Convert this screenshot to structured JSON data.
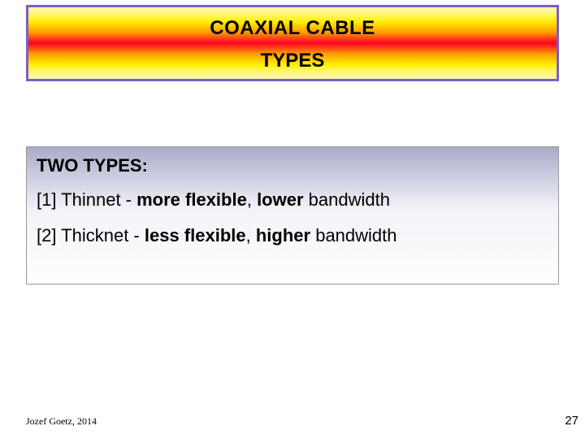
{
  "title": {
    "line1": "COAXIAL CABLE",
    "line2": "TYPES"
  },
  "content": {
    "heading": "TWO TYPES:",
    "item1": {
      "prefix": "[1] Thinnet - ",
      "bold": "more flexible",
      "mid": ", ",
      "bold2": "lower",
      "tail": " bandwidth"
    },
    "item2": {
      "prefix": "[2] Thicknet - ",
      "bold": "less flexible",
      "mid": ", ",
      "bold2": "higher",
      "tail": " bandwidth"
    }
  },
  "footer": {
    "author": "Jozef Goetz, 2014",
    "page": "27"
  }
}
